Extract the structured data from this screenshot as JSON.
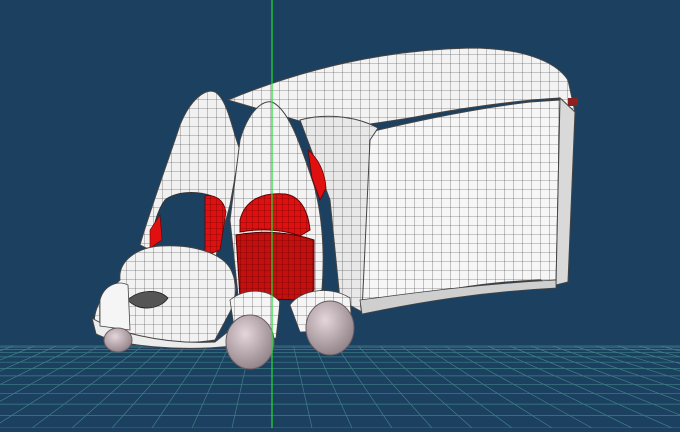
{
  "viewport": {
    "name": "3d-modeling-viewport",
    "background_color": "#1c4060",
    "grid_color": "#3f7f86",
    "axis_color": "#22dd33",
    "mesh_fill_color": "#f2f2f2",
    "mesh_wire_color": "#2a2a2a",
    "highlight_face_color": "#e01010",
    "wheel_color": "#c9b9bf"
  },
  "model": {
    "shown_as": "wireframe-shaded-mesh",
    "object_icon": "truck-icon",
    "selected_faces": [
      "left-window",
      "right-window",
      "door-panel",
      "inner-cab"
    ]
  }
}
